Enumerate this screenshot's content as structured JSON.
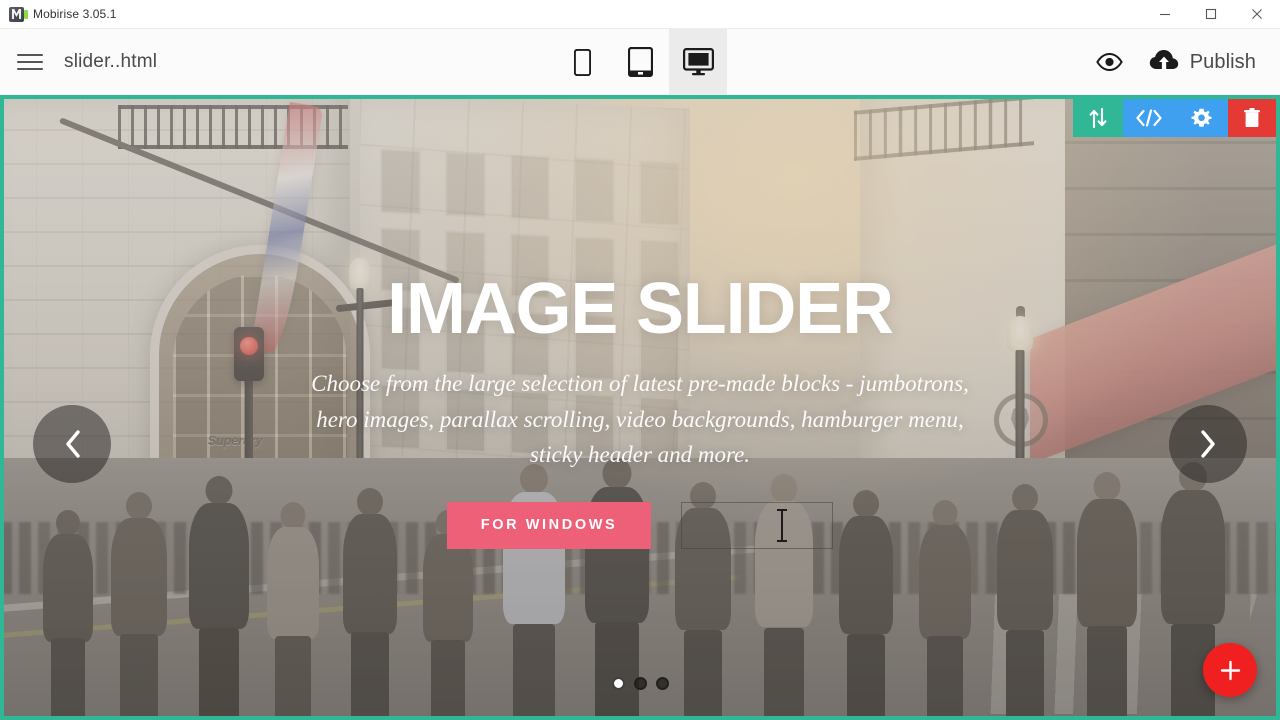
{
  "window": {
    "app_title": "Mobirise 3.05.1",
    "logo_icon": "mobirise-logo-icon",
    "controls": [
      {
        "name": "minimize",
        "icon": "minimize-icon"
      },
      {
        "name": "maximize",
        "icon": "maximize-icon"
      },
      {
        "name": "close",
        "icon": "close-icon"
      }
    ]
  },
  "toolbar": {
    "menu_icon": "hamburger-menu-icon",
    "file_name": "slider..html",
    "devices": [
      {
        "id": "mobile",
        "icon": "mobile-phone-icon",
        "active": false
      },
      {
        "id": "tablet",
        "icon": "tablet-icon",
        "active": false
      },
      {
        "id": "desktop",
        "icon": "desktop-monitor-icon",
        "active": true
      }
    ],
    "preview_icon": "eye-preview-icon",
    "publish_icon": "cloud-upload-icon",
    "publish_label": "Publish"
  },
  "block": {
    "selected": true,
    "selection_color": "#2fb796",
    "actions": [
      {
        "id": "move",
        "icon": "move-updown-arrows-icon",
        "color": "#2fb796"
      },
      {
        "id": "code",
        "icon": "code-brackets-icon",
        "color": "#3fa0ef"
      },
      {
        "id": "settings",
        "icon": "gear-icon",
        "color": "#3fa0ef"
      },
      {
        "id": "delete",
        "icon": "trash-icon",
        "color": "#e53935"
      }
    ]
  },
  "hero": {
    "title": "IMAGE SLIDER",
    "subtitle": "Choose from the large selection of latest pre-made blocks - jumbotrons, hero images, parallax scrolling, video backgrounds, hamburger menu, sticky header and more.",
    "primary_button": "FOR WINDOWS",
    "primary_button_color": "#ee5f78",
    "secondary_button": "",
    "secondary_button_editing": true,
    "background_scene": "london-regent-street-crowd-photo",
    "shop_sign": "Superdry"
  },
  "carousel": {
    "prev_icon": "chevron-left-icon",
    "next_icon": "chevron-right-icon",
    "slides": 3,
    "active_slide": 1
  },
  "fab": {
    "icon": "plus-icon",
    "color": "#f02020"
  }
}
